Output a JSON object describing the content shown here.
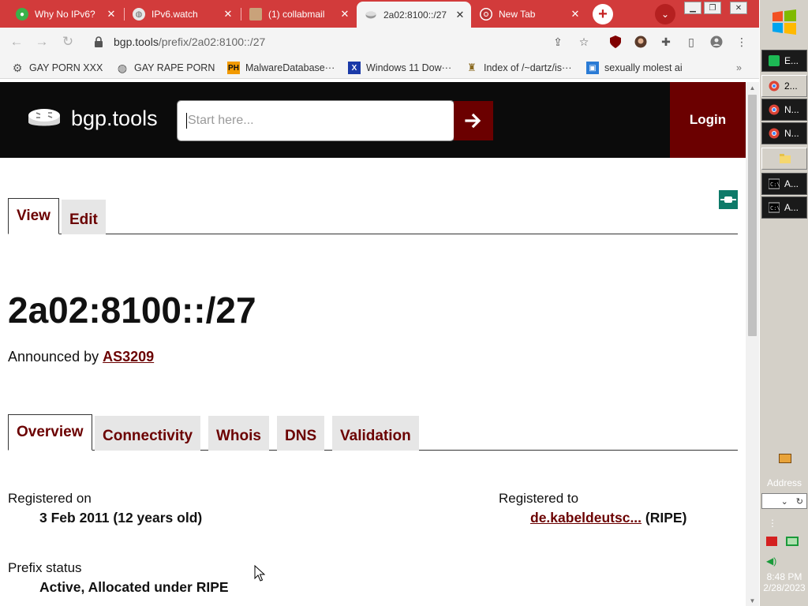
{
  "browser": {
    "tabs": [
      {
        "title": "Why No IPv6?",
        "favicon": "green-circle-icon",
        "active": false
      },
      {
        "title": "IPv6.watch",
        "favicon": "globe-icon",
        "active": false
      },
      {
        "title": "(1) collabmail",
        "favicon": "people-icon",
        "active": false
      },
      {
        "title": "2a02:8100::/27",
        "favicon": "router-icon",
        "active": true
      },
      {
        "title": "New Tab",
        "favicon": "chrome-icon",
        "active": false
      }
    ],
    "new_tab_symbol": "+",
    "tab_menu_symbol": "⌄",
    "url_domain": "bgp.tools",
    "url_path": "/prefix/2a02:8100::/27",
    "bookmarks": [
      {
        "label": "GAY PORN XXX",
        "icon": "gear-icon"
      },
      {
        "label": "GAY RAPE PORN",
        "icon": "globe-icon"
      },
      {
        "label": "MalwareDatabase···",
        "icon": "ph-icon"
      },
      {
        "label": "Windows 11 Dow···",
        "icon": "x-icon"
      },
      {
        "label": "Index of /~dartz/is···",
        "icon": "person-icon"
      },
      {
        "label": "sexually molest ai",
        "icon": "image-icon"
      }
    ],
    "bookmarks_more": "»",
    "accent_color": "#d23b3b"
  },
  "site": {
    "name": "bgp.tools",
    "search_placeholder": "Start here...",
    "login_label": "Login",
    "brand_color": "#6b0000"
  },
  "page": {
    "view_tabs": [
      {
        "label": "View",
        "active": true
      },
      {
        "label": "Edit",
        "active": false
      }
    ],
    "prefix": "2a02:8100::/27",
    "announced_by_label": "Announced by",
    "announced_by_asn": "AS3209",
    "section_tabs": [
      {
        "label": "Overview",
        "active": true
      },
      {
        "label": "Connectivity",
        "active": false
      },
      {
        "label": "Whois",
        "active": false
      },
      {
        "label": "DNS",
        "active": false
      },
      {
        "label": "Validation",
        "active": false
      }
    ],
    "registered_on_label": "Registered on",
    "registered_on_value": "3 Feb 2011 (12 years old)",
    "registered_to_label": "Registered to",
    "registered_to_link": "de.kabeldeutsc...",
    "registered_to_rir": "(RIPE)",
    "prefix_status_label": "Prefix status",
    "prefix_status_value": "Active, Allocated under RIPE"
  },
  "taskbar": {
    "tasks": [
      {
        "label": "E...",
        "icon": "spotify-icon"
      },
      {
        "label": "2...",
        "icon": "chrome-icon"
      },
      {
        "label": "N...",
        "icon": "chrome-icon"
      },
      {
        "label": "N...",
        "icon": "chrome-icon"
      },
      {
        "label": "",
        "icon": "folder-icon"
      },
      {
        "label": "A...",
        "icon": "cmd-icon"
      },
      {
        "label": "A...",
        "icon": "cmd-icon"
      }
    ],
    "address_label": "Address",
    "clock_time": "8:48 PM",
    "clock_date": "2/28/2023"
  }
}
